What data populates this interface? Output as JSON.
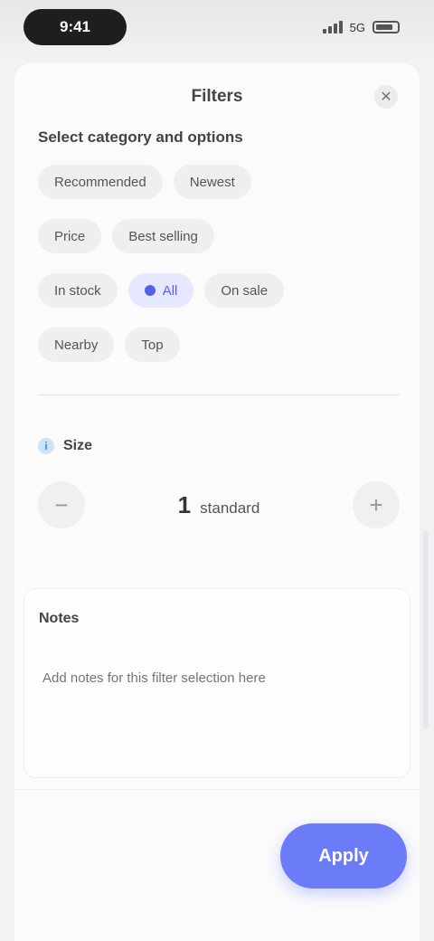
{
  "status_bar": {
    "time": "9:41",
    "network": "5G"
  },
  "header": {
    "title": "Filters",
    "close_symbol": "✕"
  },
  "category_section": {
    "heading": "Select category and options",
    "rows": [
      [
        {
          "label": "Recommended",
          "selected": false
        },
        {
          "label": "Newest",
          "selected": false
        }
      ],
      [
        {
          "label": "Price",
          "selected": false
        },
        {
          "label": "Best selling",
          "selected": false
        }
      ],
      [
        {
          "label": "In stock",
          "selected": false
        },
        {
          "label": "All",
          "selected": true
        },
        {
          "label": "On sale",
          "selected": false
        }
      ],
      [
        {
          "label": "Nearby",
          "selected": false
        },
        {
          "label": "Top",
          "selected": false
        }
      ]
    ]
  },
  "size_section": {
    "label": "Size",
    "info_symbol": "i",
    "minus_symbol": "−",
    "plus_symbol": "+",
    "value": "1",
    "unit": "standard"
  },
  "notes_section": {
    "heading": "Notes",
    "placeholder": "Add notes for this filter selection here"
  },
  "footer": {
    "apply_label": "Apply"
  },
  "colors": {
    "accent": "#6c7cf8",
    "selected_chip_bg": "#e6e8ff"
  }
}
